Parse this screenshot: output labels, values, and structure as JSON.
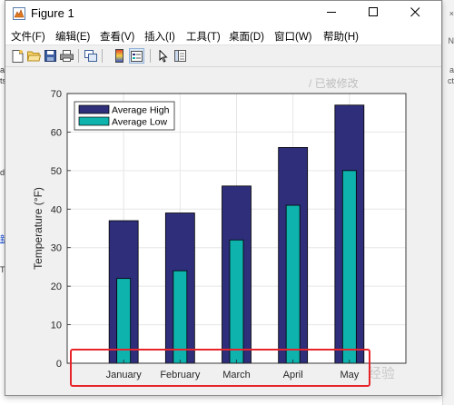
{
  "window": {
    "title": "Figure 1",
    "buttons": {
      "minimize": "minimize",
      "maximize": "maximize",
      "close": "close"
    }
  },
  "menu": [
    "文件(F)",
    "编辑(E)",
    "查看(V)",
    "插入(I)",
    "工具(T)",
    "桌面(D)",
    "窗口(W)",
    "帮助(H)"
  ],
  "toolbar": [
    "new-figure-icon",
    "open-file-icon",
    "save-icon",
    "print-icon",
    "link-plot-icon",
    "colorbar-icon",
    "legend-icon",
    "pointer-icon",
    "property-editor-icon"
  ],
  "background": {
    "left_fragments": [
      "a",
      "ts",
      "d",
      "新",
      "T"
    ],
    "right_fragments": [
      "×",
      "N",
      "a",
      "ct"
    ]
  },
  "watermarks": [
    "/ 已被修改",
    "经验"
  ],
  "colors": {
    "high": "#2e2e7a",
    "low": "#0fb3ad",
    "highlight": "#e8242b"
  },
  "chart_data": {
    "type": "bar",
    "categories": [
      "January",
      "February",
      "March",
      "April",
      "May"
    ],
    "series": [
      {
        "name": "Average High",
        "values": [
          37,
          39,
          46,
          56,
          67
        ]
      },
      {
        "name": "Average Low",
        "values": [
          22,
          24,
          32,
          41,
          50
        ]
      }
    ],
    "title": "",
    "xlabel": "",
    "ylabel": "Temperature (°F)",
    "ylim": [
      0,
      70
    ],
    "yticks": [
      "0",
      "10",
      "20",
      "30",
      "40",
      "50",
      "60",
      "70"
    ],
    "grid": true,
    "legend_position": "top-left"
  }
}
